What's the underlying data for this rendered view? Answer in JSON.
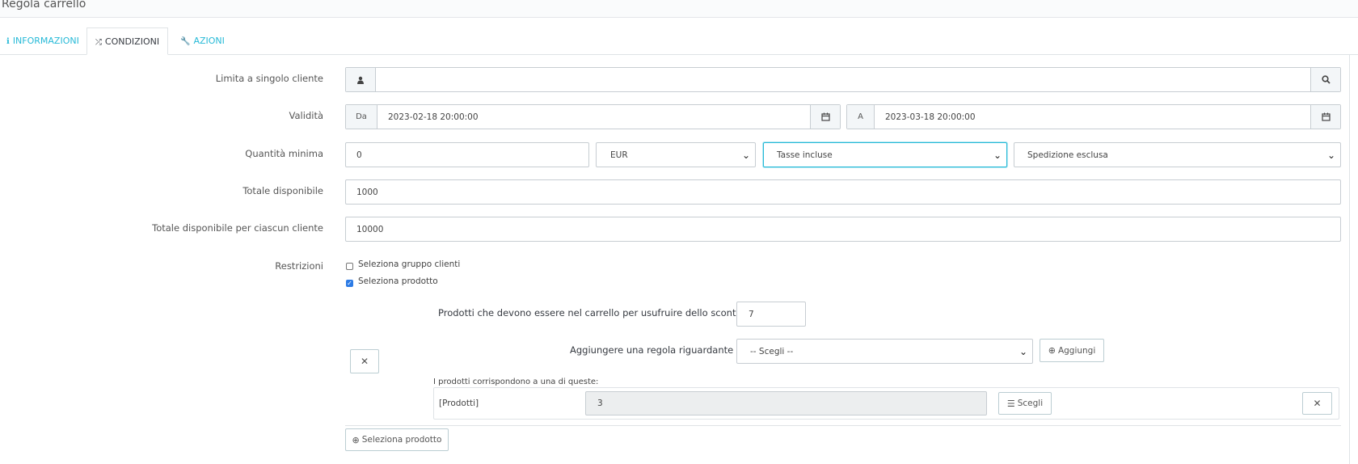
{
  "header": {
    "title": "Regola carrello"
  },
  "tabs": [
    {
      "label": "INFORMAZIONI",
      "icon": "info-icon",
      "active": false
    },
    {
      "label": "CONDIZIONI",
      "icon": "shuffle-icon",
      "active": true
    },
    {
      "label": "AZIONI",
      "icon": "wrench-icon",
      "active": false
    }
  ],
  "form": {
    "single_customer": {
      "label": "Limita a singolo cliente",
      "value": ""
    },
    "validity": {
      "label": "Validità",
      "from_label": "Da",
      "from_value": "2023-02-18 20:00:00",
      "to_label": "A",
      "to_value": "2023-03-18 20:00:00"
    },
    "min_amount": {
      "label": "Quantità minima",
      "value": "0",
      "currency": "EUR",
      "tax": "Tasse incluse",
      "shipping": "Spedizione esclusa"
    },
    "total_available": {
      "label": "Totale disponibile",
      "value": "1000"
    },
    "total_per_customer": {
      "label": "Totale disponibile per ciascun cliente",
      "value": "10000"
    },
    "restrictions": {
      "label": "Restrizioni",
      "customer_group": {
        "label": "Seleziona gruppo clienti",
        "checked": false
      },
      "product": {
        "label": "Seleziona prodotto",
        "checked": true
      }
    },
    "product_rule": {
      "quantity_label": "Prodotti che devono essere nel carrello per usufruire dello sconto:",
      "quantity_value": "7",
      "add_rule_label": "Aggiungere una regola riguardante",
      "add_rule_select": "-- Scegli --",
      "add_button": "Aggiungi",
      "matches_label": "I prodotti corrispondono a una di queste:",
      "rule_type": "[Prodotti]",
      "rule_value": "3",
      "choose_button": "Scegli"
    },
    "select_product_button": "Seleziona prodotto"
  }
}
